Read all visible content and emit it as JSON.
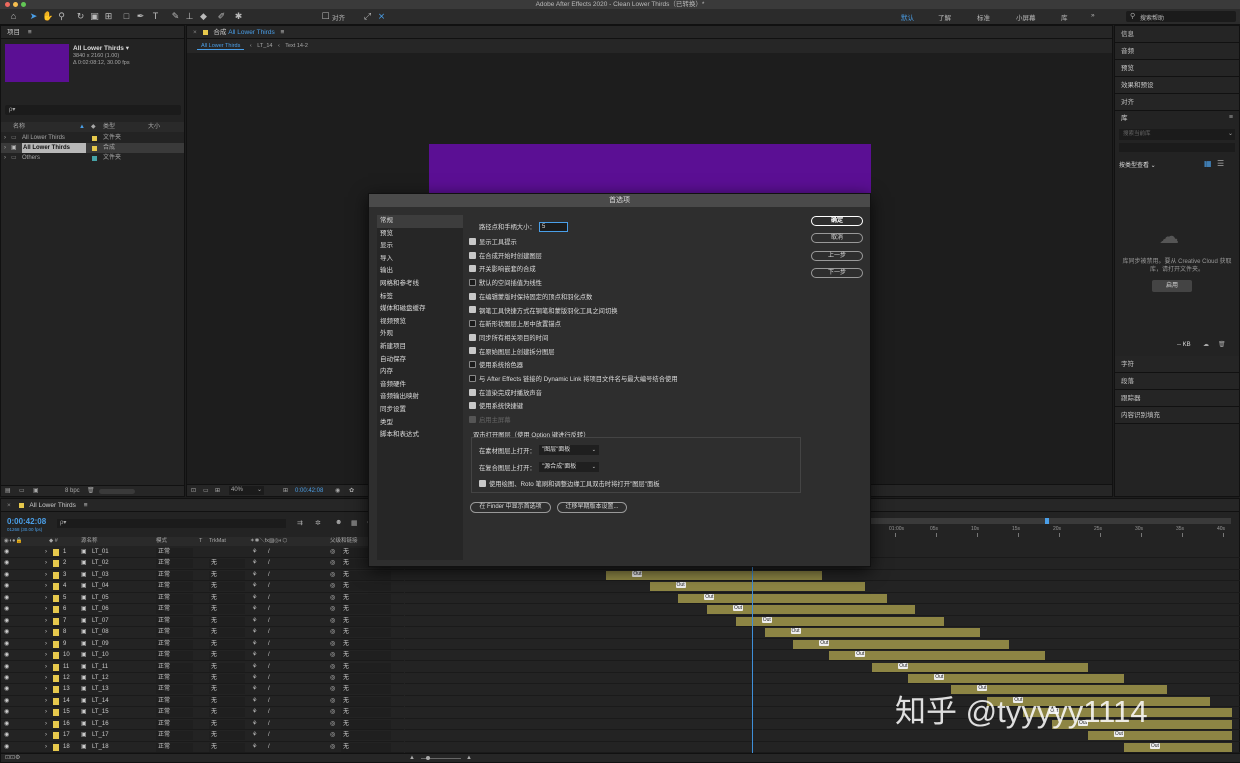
{
  "app": {
    "title": "Adobe After Effects 2020 - Clean Lower Thirds（已转换）*",
    "workspaces": [
      "默认",
      "了解",
      "标准",
      "小屏幕",
      "库"
    ],
    "active_workspace": "默认",
    "search_help_placeholder": "搜索帮助",
    "align_label": "对齐"
  },
  "project": {
    "panel_title": "项目",
    "selected_name": "All Lower Thirds ▾",
    "selected_res": "3840 x 2160 (1.00)",
    "selected_dur": "Δ 0:02:08:12, 30.00 fps",
    "thumb_color": "#5b0f94",
    "search_placeholder": "ρ▾",
    "col_name": "名称",
    "col_type": "类型",
    "col_size": "大小",
    "items": [
      {
        "name": "All Lower Thirds",
        "type": "文件夹",
        "color": "#e6c84c"
      },
      {
        "name": "All Lower Thirds",
        "type": "合成",
        "color": "#e6c84c"
      },
      {
        "name": "Others",
        "type": "文件夹",
        "color": "#46a2a6"
      }
    ],
    "bpc": "8 bpc"
  },
  "comp": {
    "panel_title": "合成",
    "comp_name": "All Lower Thirds",
    "tabs": [
      "All Lower Thirds",
      "LT_14",
      "Text 14-2"
    ],
    "frame_color": "#5b0f94",
    "zoom": "40%",
    "time": "0:00:42:08"
  },
  "dialog": {
    "title": "首选项",
    "categories": [
      "常规",
      "预览",
      "显示",
      "导入",
      "输出",
      "网格和参考线",
      "标签",
      "媒体和磁盘缓存",
      "视频预览",
      "外观",
      "新建项目",
      "自动保存",
      "内存",
      "音频硬件",
      "音频输出映射",
      "同步设置",
      "类型",
      "脚本和表达式"
    ],
    "selected_category": "常规",
    "path_label": "路径点和手柄大小：",
    "path_value": "5",
    "options": [
      {
        "label": "显示工具提示",
        "state": "on"
      },
      {
        "label": "在合成开始时创建图层",
        "state": "on"
      },
      {
        "label": "开关影响嵌套的合成",
        "state": "on"
      },
      {
        "label": "默认的空间插值为线性",
        "state": "off"
      },
      {
        "label": "在编辑蒙版时保持固定的顶点和羽化点数",
        "state": "on"
      },
      {
        "label": "钢笔工具快捷方式在钢笔和蒙版羽化工具之间切换",
        "state": "on"
      },
      {
        "label": "在新形状图层上居中放置锚点",
        "state": "off"
      },
      {
        "label": "同步所有相关项目的时间",
        "state": "on"
      },
      {
        "label": "在原始图层上创建拆分图层",
        "state": "on"
      },
      {
        "label": "使用系统拾色器",
        "state": "off"
      },
      {
        "label": "与 After Effects 链接的 Dynamic Link 将项目文件名与最大编号结合使用",
        "state": "off"
      },
      {
        "label": "在渲染完成时播放声音",
        "state": "on"
      },
      {
        "label": "使用系统快捷键",
        "state": "on"
      },
      {
        "label": "启用主屏幕",
        "state": "disabled"
      }
    ],
    "group_title": "双击打开图层（使用 Option 键进行反转）",
    "footage_label": "在素材图层上打开：",
    "footage_value": "\"图层\"面板",
    "comp_label": "在复合图层上打开：",
    "comp_value": "\"源合成\"面板",
    "paint_label": "使用绘图、Roto 笔刷和调整边缘工具双击时将打开\"图层\"面板",
    "finder_btn": "在 Finder 中显示首选项",
    "migrate_btn": "迁移早期版本设置...",
    "ok": "确定",
    "cancel": "取消",
    "prev": "上一步",
    "next": "下一步"
  },
  "right_panel": {
    "items_top": [
      "信息",
      "音频",
      "预览",
      "效果和预设",
      "对齐"
    ],
    "library_title": "库",
    "library_search": "搜索当前库",
    "view_by_type": "按类型查看",
    "sync_message": "库同步被禁用。要从 Creative Cloud 获取库，请打开文件夹。",
    "enable_btn": "启用",
    "kb": "-- KB",
    "items_bottom": [
      "字符",
      "段落",
      "跟踪器",
      "内容识别填充"
    ]
  },
  "timeline": {
    "comp_tab": "All Lower Thirds",
    "time": "0:00:42:08",
    "frames": "01268 (30.00 fps)",
    "search_placeholder": "ρ▾",
    "col_layer_name": "源名称",
    "col_mode": "模式",
    "col_t": "T",
    "col_trkmat": "TrkMat",
    "col_parent": "父级和链接",
    "ruler_ticks": [
      "01:00s",
      "05s",
      "10s",
      "15s",
      "20s",
      "25s",
      "30s",
      "35s",
      "40s"
    ],
    "mode_value": "正常",
    "trkmat_value": "无",
    "parent_value": "无",
    "out_label": "Out",
    "layers": [
      {
        "num": "1",
        "name": "LT_01",
        "start": 0.0,
        "end": 0.0
      },
      {
        "num": "2",
        "name": "LT_02",
        "start": 0.0,
        "end": 0.0
      },
      {
        "num": "3",
        "name": "LT_03",
        "start": 0.13,
        "end": 0.43
      },
      {
        "num": "4",
        "name": "LT_04",
        "start": 0.19,
        "end": 0.49
      },
      {
        "num": "5",
        "name": "LT_05",
        "start": 0.23,
        "end": 0.52
      },
      {
        "num": "6",
        "name": "LT_06",
        "start": 0.27,
        "end": 0.56
      },
      {
        "num": "7",
        "name": "LT_07",
        "start": 0.31,
        "end": 0.6
      },
      {
        "num": "8",
        "name": "LT_08",
        "start": 0.35,
        "end": 0.65
      },
      {
        "num": "9",
        "name": "LT_09",
        "start": 0.39,
        "end": 0.69
      },
      {
        "num": "10",
        "name": "LT_10",
        "start": 0.44,
        "end": 0.74
      },
      {
        "num": "11",
        "name": "LT_11",
        "start": 0.5,
        "end": 0.8
      },
      {
        "num": "12",
        "name": "LT_12",
        "start": 0.55,
        "end": 0.85
      },
      {
        "num": "13",
        "name": "LT_13",
        "start": 0.61,
        "end": 0.91
      },
      {
        "num": "14",
        "name": "LT_14",
        "start": 0.66,
        "end": 0.97
      },
      {
        "num": "15",
        "name": "LT_15",
        "start": 0.71,
        "end": 1.0
      },
      {
        "num": "16",
        "name": "LT_16",
        "start": 0.75,
        "end": 1.0
      },
      {
        "num": "17",
        "name": "LT_17",
        "start": 0.8,
        "end": 1.0
      },
      {
        "num": "18",
        "name": "LT_18",
        "start": 0.85,
        "end": 1.0
      }
    ],
    "label_color": "#e6c84c",
    "bar_color": "#8d8544",
    "playhead_color": "#3f8fd8"
  },
  "watermark": "知乎 @tyyyyy1114"
}
